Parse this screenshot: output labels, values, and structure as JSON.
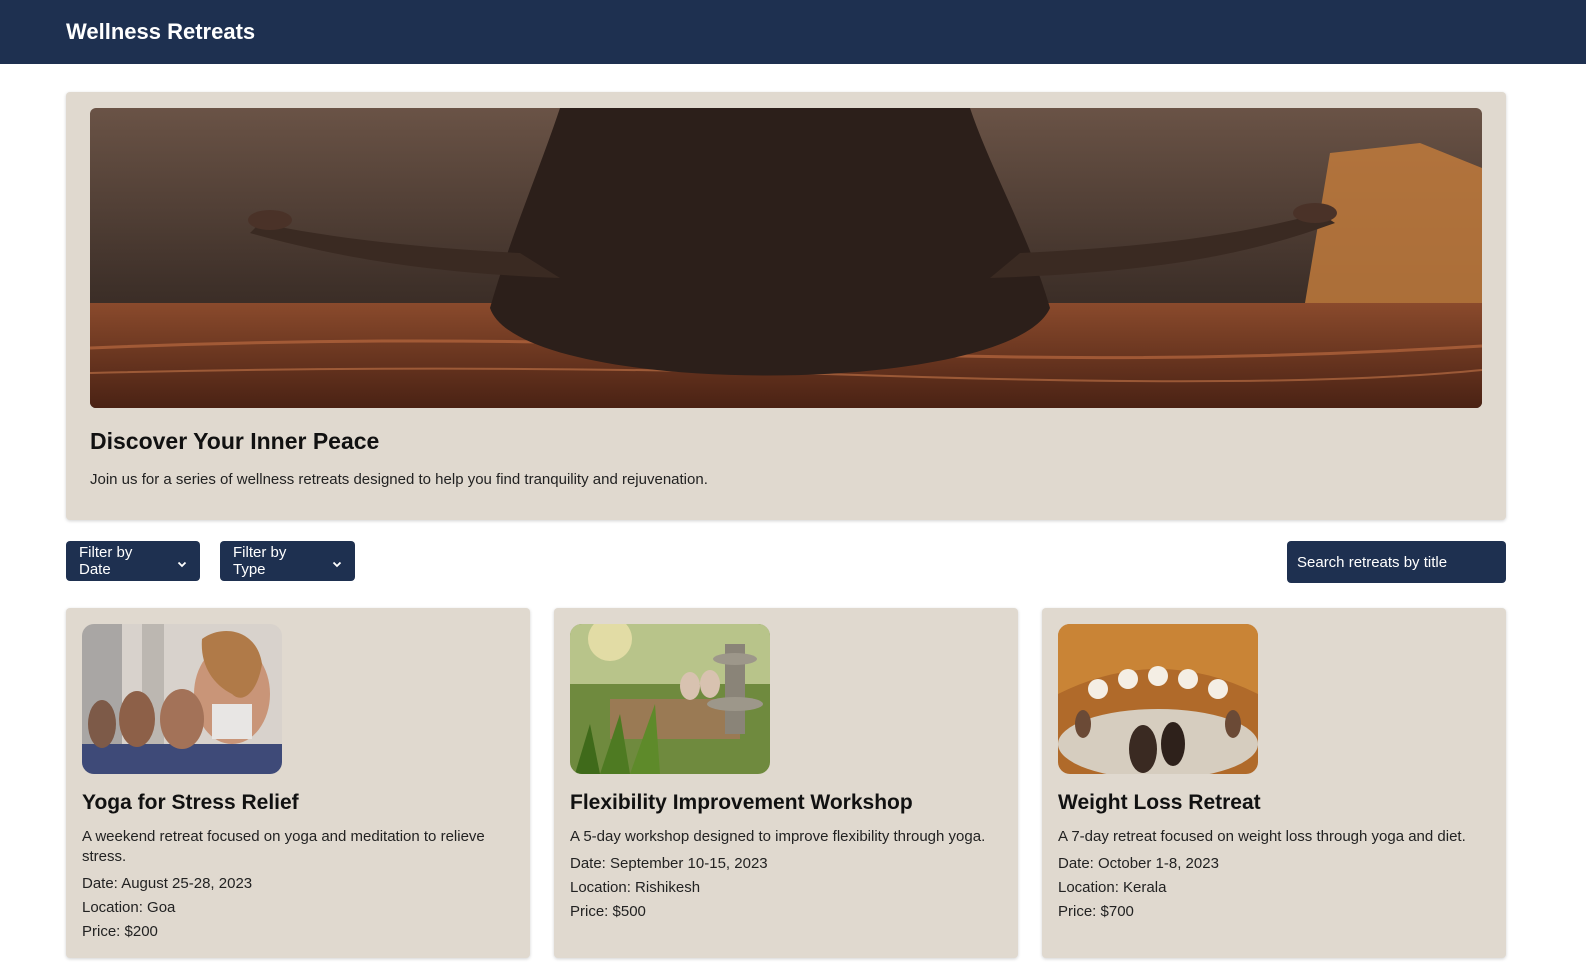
{
  "header": {
    "title": "Wellness Retreats"
  },
  "hero": {
    "image": "meditation-banner-image",
    "title": "Discover Your Inner Peace",
    "subtitle": "Join us for a series of wellness retreats designed to help you find tranquility and rejuvenation."
  },
  "filters": {
    "date_label": "Filter by Date",
    "type_label": "Filter by Type",
    "search_placeholder": "Search retreats by title"
  },
  "retreats": [
    {
      "image": "group-yoga-class-image",
      "title": "Yoga for Stress Relief",
      "description": "A weekend retreat focused on yoga and meditation to relieve stress.",
      "date": "Date: August 25-28, 2023",
      "location": "Location: Goa",
      "price": "Price: $200"
    },
    {
      "image": "garden-fountain-yoga-image",
      "title": "Flexibility Improvement Workshop",
      "description": "A 5-day workshop designed to improve flexibility through yoga.",
      "date": "Date: September 10-15, 2023",
      "location": "Location: Rishikesh",
      "price": "Price: $500"
    },
    {
      "image": "dome-meditation-hall-image",
      "title": "Weight Loss Retreat",
      "description": "A 7-day retreat focused on weight loss through yoga and diet.",
      "date": "Date: October 1-8, 2023",
      "location": "Location: Kerala",
      "price": "Price: $700"
    }
  ],
  "colors": {
    "navbar": "#1e3050",
    "panel": "#e0d9cf",
    "text": "#111111"
  }
}
